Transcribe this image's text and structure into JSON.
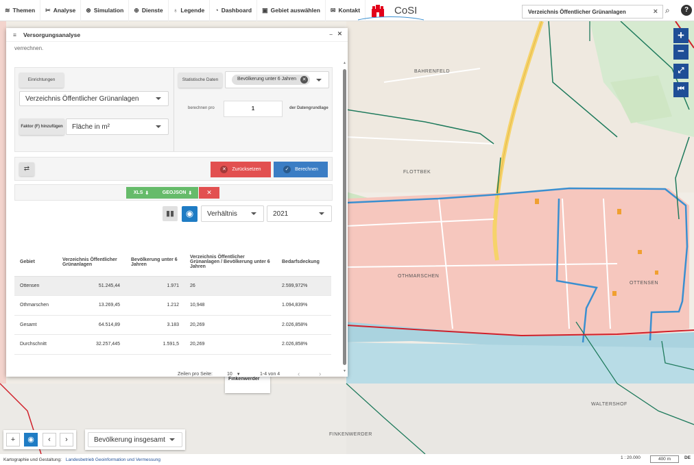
{
  "nav": [
    {
      "label": "Themen",
      "icon": "layers-icon",
      "glyph": "≋"
    },
    {
      "label": "Analyse",
      "icon": "tools-icon",
      "glyph": "✂"
    },
    {
      "label": "Simulation",
      "icon": "simulation-icon",
      "glyph": "⊛"
    },
    {
      "label": "Dienste",
      "icon": "services-icon",
      "glyph": "⊕"
    },
    {
      "label": "Legende",
      "icon": "bulb-icon",
      "glyph": "♁"
    },
    {
      "label": "Dashboard",
      "icon": "dashboard-icon",
      "glyph": "◔"
    },
    {
      "label": "Gebiet auswählen",
      "icon": "image-icon",
      "glyph": "▣"
    },
    {
      "label": "Kontakt",
      "icon": "mail-icon",
      "glyph": "✉"
    }
  ],
  "brand": {
    "name": "CoSI"
  },
  "search": {
    "value": "Verzeichnis Öffentlicher Grünanlagen"
  },
  "map_controls": {
    "help": "?"
  },
  "panel": {
    "title": "Versorgungsanalyse",
    "cutoff_text": "verrechnen.",
    "einrichtungen_label": "Einrichtungen",
    "einrichtung_select": "Verzeichnis Öffentlicher Grünanlagen",
    "faktor_label": "Faktor (F) hinzufügen",
    "faktor_select": "Fläche in m²",
    "stat_label": "Statistische Daten",
    "stat_chip": "Bevölkerung unter 6 Jahren",
    "berechnen_pro": "berechnen pro",
    "berechnen_value": "1",
    "datengrundlage": "der Datengrundlage",
    "reset_label": "Zurücksetzen",
    "calc_label": "Berechnen",
    "xls_label": "XLS",
    "geojson_label": "GEOJSON",
    "mode_select": "Verhältnis",
    "year_select": "2021"
  },
  "table": {
    "headers": [
      "Gebiet",
      "Verzeichnis Öffentlicher Grünanlagen",
      "Bevölkerung unter 6 Jahren",
      "Verzeichnis Öffentlicher Grünanlagen / Bevölkerung unter 6 Jahren",
      "Bedarfsdeckung"
    ],
    "rows": [
      [
        "Ottensen",
        "51.245,44",
        "1.971",
        "26",
        "2.599,972%"
      ],
      [
        "Othmarschen",
        "13.269,45",
        "1.212",
        "10,948",
        "1.094,839%"
      ],
      [
        "Gesamt",
        "64.514,89",
        "3.183",
        "20,269",
        "2.026,858%"
      ],
      [
        "Durchschnitt",
        "32.257,445",
        "1.591,5",
        "20,269",
        "2.026,858%"
      ]
    ],
    "rows_per_page_label": "Zeilen pro Seite:",
    "rows_per_page": "10",
    "range": "1-4 von 4"
  },
  "bottom": {
    "population_select": "Bevölkerung insgesamt"
  },
  "footer": {
    "credit_label": "Kartographie und Gestaltung:",
    "credit_link": "Landesbetrieb Geoinformation und Vermessung",
    "scale": "1 : 20.000",
    "scalebar": "400 m",
    "lang": "DE"
  },
  "map_labels": {
    "bahrenfeld": "BAHRENFELD",
    "flottbek": "FLOTTBEK",
    "othmarschen": "OTHMARSCHEN",
    "ottensen": "OTTENSEN",
    "waltershof": "WALTERSHOF",
    "finkenwerder": "FINKENWERDER",
    "finkenwerder_popup": "Finkenwerder"
  },
  "colors": {
    "accent": "#1f4e96",
    "reset": "#e25050",
    "calc": "#3b7dc4",
    "export": "#66bb6a",
    "district": "#3a8fd0",
    "boundary": "#d0202a"
  }
}
